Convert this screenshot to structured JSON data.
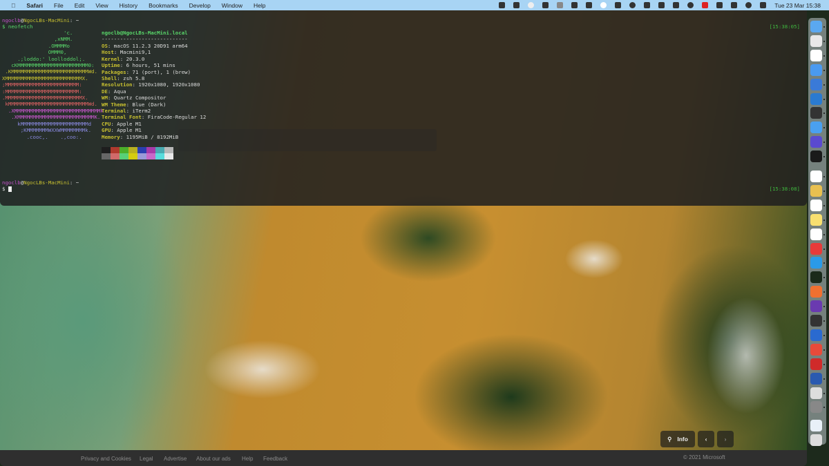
{
  "menubar": {
    "app": "Safari",
    "items": [
      "File",
      "Edit",
      "View",
      "History",
      "Bookmarks",
      "Develop",
      "Window",
      "Help"
    ],
    "clock": "Tue 23 Mar  15:38"
  },
  "terminal": {
    "prompt_user": "ngoclb",
    "prompt_at": "@",
    "prompt_host": "NgocLBs-MacMini",
    "prompt_path": ": ~",
    "command": "$ neofetch",
    "time1": "[15:38:05]",
    "time2": "[15:38:08]",
    "dollar": "$ ",
    "logo": [
      "                    'c.",
      "                 ,xNMM.",
      "               .OMMMMo",
      "               OMMM0,",
      "     .;loddo:' loolloddol;.",
      "   cKMMMMMMMMMMMMMMMMMMMMMMM0:",
      " .KMMMMMMMMMMMMMMMMMMMMMMMMMWd.",
      "XMMMMMMMMMMMMMMMMMMMMMMMMMX.",
      ";MMMMMMMMMMMMMMMMMMMMMMMM:",
      ":MMMMMMMMMMMMMMMMMMMMMMMM:",
      ".MMMMMMMMMMMMMMMMMMMMMMMMMX.",
      " kMMMMMMMMMMMMMMMMMMMMMMMMMMWd.",
      "  .XMMMMMMMMMMMMMMMMMMMMMMMMMMMMk",
      "   .XMMMMMMMMMMMMMMMMMMMMMMMMMK.",
      "     kMMMMMMMMMMMMMMMMMMMMMMd",
      "      ;KMMMMMMMWXXWMMMMMMMMk.",
      "        .cooc,.    .,coo:."
    ],
    "header": "ngoclb@NgocLBs-MacMini.local",
    "separator": "----------------------------",
    "info": [
      [
        "OS",
        ": macOS 11.2.3 20D91 arm64"
      ],
      [
        "Host",
        ": Macmini9,1"
      ],
      [
        "Kernel",
        ": 20.3.0"
      ],
      [
        "Uptime",
        ": 6 hours, 51 mins"
      ],
      [
        "Packages",
        ": 71 (port), 1 (brew)"
      ],
      [
        "Shell",
        ": zsh 5.8"
      ],
      [
        "Resolution",
        ": 1920x1080, 1920x1080"
      ],
      [
        "DE",
        ": Aqua"
      ],
      [
        "WM",
        ": Quartz Compositor"
      ],
      [
        "WM Theme",
        ": Blue (Dark)"
      ],
      [
        "Terminal",
        ": iTerm2"
      ],
      [
        "Terminal Font",
        ": FiraCode-Regular 12"
      ],
      [
        "CPU",
        ": Apple M1"
      ],
      [
        "GPU",
        ": Apple M1"
      ],
      [
        "Memory",
        ": 1195MiB / 8192MiB"
      ]
    ],
    "palette1": [
      "#1e1e1e",
      "#b03a2e",
      "#4caf2a",
      "#b8b020",
      "#2a3fb0",
      "#a83aa8",
      "#48aab0",
      "#b8b8b8"
    ],
    "palette2": [
      "#666666",
      "#d06a6a",
      "#58d078",
      "#d4cc10",
      "#9a9ad8",
      "#c868c8",
      "#58dcdc",
      "#e8e8e8"
    ]
  },
  "footer": {
    "links": [
      "Privacy and Cookies",
      "Legal",
      "Advertise",
      "About our ads",
      "Help",
      "Feedback"
    ],
    "copyright": "© 2021 Microsoft",
    "info": "Info"
  },
  "dock": {
    "apps": [
      [
        "finder",
        "#5aa8f0"
      ],
      [
        "launchpad",
        "#e8e8e8"
      ],
      [
        "calendar",
        "#ffffff"
      ],
      [
        "mail",
        "#4a9af0"
      ],
      [
        "xcode",
        "#3a7ad8"
      ],
      [
        "vscode",
        "#2a7ad0"
      ],
      [
        "sublime",
        "#333333"
      ],
      [
        "safari",
        "#4aa0f0"
      ],
      [
        "notes-app",
        "#5a4ad0"
      ],
      [
        "terminal",
        "#1a1a1a"
      ],
      [
        "zalo",
        "#ffffff"
      ],
      [
        "sequel",
        "#e8c050"
      ],
      [
        "wave",
        "#ffffff"
      ],
      [
        "notes",
        "#f8e070"
      ],
      [
        "chrome",
        "#ffffff"
      ],
      [
        "anydesk",
        "#e83a3a"
      ],
      [
        "skype",
        "#2a9ae8"
      ],
      [
        "iterm",
        "#1a2a1a"
      ],
      [
        "postman",
        "#f07030"
      ],
      [
        "github",
        "#6a3ab0"
      ],
      [
        "tableplus",
        "#333333"
      ],
      [
        "sourcetree",
        "#2a6ad0"
      ],
      [
        "fork",
        "#e84a3a"
      ],
      [
        "lastpass",
        "#d02a2a"
      ],
      [
        "word",
        "#2a5ab0"
      ],
      [
        "disk-utility",
        "#dddddd"
      ],
      [
        "preferences",
        "#888888"
      ],
      [
        "documents",
        "#e8f0f8"
      ],
      [
        "trash",
        "#dddddd"
      ]
    ]
  }
}
